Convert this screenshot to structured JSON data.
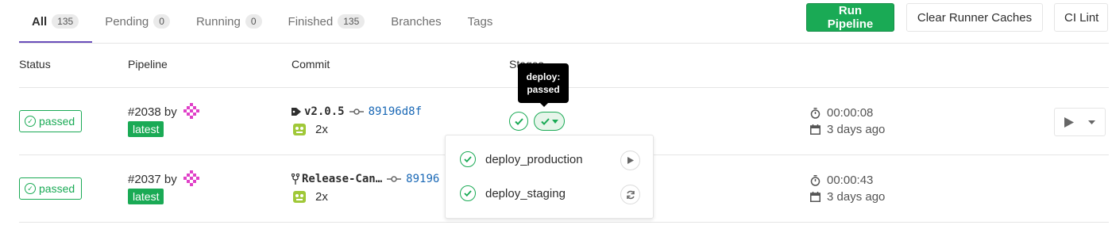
{
  "tabs": [
    {
      "label": "All",
      "count": "135",
      "active": true
    },
    {
      "label": "Pending",
      "count": "0"
    },
    {
      "label": "Running",
      "count": "0"
    },
    {
      "label": "Finished",
      "count": "135"
    },
    {
      "label": "Branches"
    },
    {
      "label": "Tags"
    }
  ],
  "actions": {
    "run_pipeline": "Run Pipeline",
    "clear_caches": "Clear Runner Caches",
    "ci_lint": "CI Lint"
  },
  "table": {
    "headers": {
      "status": "Status",
      "pipeline": "Pipeline",
      "commit": "Commit",
      "stages": "Stages"
    }
  },
  "pipelines": [
    {
      "status": "passed",
      "id": "#2038",
      "by": "by",
      "tag": "latest",
      "ref": "v2.0.5",
      "ref_type": "tag",
      "sha": "89196d8f",
      "author_count": "2x",
      "duration": "00:00:08",
      "finished": "3 days ago"
    },
    {
      "status": "passed",
      "id": "#2037",
      "by": "by",
      "tag": "latest",
      "ref": "Release-Can…",
      "ref_type": "branch",
      "sha": "89196",
      "author_count": "2x",
      "duration": "00:00:43",
      "finished": "3 days ago"
    }
  ],
  "tooltip": {
    "line1": "deploy:",
    "line2": "passed"
  },
  "stage_dropdown": {
    "jobs": [
      {
        "name": "deploy_production",
        "action_icon": "play-icon"
      },
      {
        "name": "deploy_staging",
        "action_icon": "retry-icon"
      }
    ]
  },
  "colors": {
    "success": "#1aaa55",
    "accent": "#6b4fbb",
    "link": "#1b69b6"
  }
}
